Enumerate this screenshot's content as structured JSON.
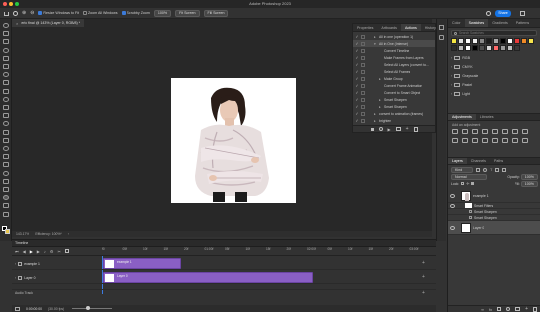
{
  "app": {
    "title": "Adobe Photoshop 2023"
  },
  "options_bar": {
    "resize_windows": "Resize Windows to Fit",
    "zoom_all": "Zoom All Windows",
    "scrubby_zoom": "Scrubby Zoom",
    "zoom_level": "100%",
    "fit_screen": "Fit Screen",
    "fill_screen": "Fill Screen",
    "share": "Share"
  },
  "document": {
    "tab_label": "eric final @ 143% (Layer 0, RGB/8) *"
  },
  "status": {
    "zoom": "143.17%",
    "efficiency": "Efficiency: 100%*"
  },
  "actions_panel": {
    "tabs": [
      "Properties",
      "Artboards",
      "Actions",
      "History"
    ],
    "items": [
      {
        "label": "All in one (operation 1)",
        "indent": 1,
        "arrow": "▸"
      },
      {
        "label": "All in One (Intense)",
        "indent": 1,
        "arrow": "▾"
      },
      {
        "label": "Convert Timeline",
        "indent": 2,
        "arrow": ""
      },
      {
        "label": "Make Frames from Layers",
        "indent": 2,
        "arrow": ""
      },
      {
        "label": "Select All Layers (convert to...",
        "indent": 2,
        "arrow": ""
      },
      {
        "label": "Select All Frames",
        "indent": 2,
        "arrow": ""
      },
      {
        "label": "Make Group",
        "indent": 2,
        "arrow": "▸"
      },
      {
        "label": "Convert Frame Animation",
        "indent": 2,
        "arrow": ""
      },
      {
        "label": "Convert to Smart Object",
        "indent": 2,
        "arrow": ""
      },
      {
        "label": "Smart Sharpen",
        "indent": 2,
        "arrow": "▸"
      },
      {
        "label": "Smart Sharpen",
        "indent": 2,
        "arrow": "▸"
      },
      {
        "label": "convert to animation (frames)",
        "indent": 1,
        "arrow": "▸"
      },
      {
        "label": "brighten",
        "indent": 1,
        "arrow": "▸"
      },
      {
        "label": "Strided on Clarity",
        "indent": 0,
        "arrow": "▸"
      }
    ]
  },
  "color_panel": {
    "tabs": [
      "Color",
      "Swatches",
      "Gradients",
      "Patterns"
    ],
    "search_placeholder": "Search Swatches",
    "swatches": [
      "#f5e642",
      "#e0e0e0",
      "#ffffff",
      "#f2f2f2",
      "#888888",
      "#1c1c1c",
      "#aaaaaa",
      "#000000",
      "#ffffff",
      "#e93a3a",
      "#f08a26",
      "#f6e34c",
      "#2d2d2d",
      "#bbbbbb",
      "#ffffff",
      "#000000",
      "#4d4d4d",
      "#d6d6d6",
      "#ff6a6a",
      "#9b9b9b",
      "#bdbdbd",
      "#3a3a3a"
    ],
    "folders": [
      "RGB",
      "CMYK",
      "Grayscale",
      "Pastel",
      "Light"
    ]
  },
  "adjustments_panel": {
    "tabs": [
      "Adjustments",
      "Libraries"
    ],
    "add_label": "Add an adjustment"
  },
  "layers_panel": {
    "tabs": [
      "Layers",
      "Channels",
      "Paths"
    ],
    "kind": "Kind",
    "blend_mode": "Normal",
    "opacity_label": "Opacity:",
    "opacity": "100%",
    "lock_label": "Lock:",
    "fill_label": "Fill:",
    "fill": "100%",
    "layers": [
      {
        "name": "example 1",
        "type": "photo",
        "indent": 0
      },
      {
        "name": "Smart Filters",
        "type": "filter",
        "indent": 1
      },
      {
        "name": "Smart Sharpen",
        "type": "sub",
        "indent": 2
      },
      {
        "name": "Smart Sharpen",
        "type": "sub",
        "indent": 2
      },
      {
        "name": "Layer 0",
        "type": "white",
        "indent": 0
      }
    ]
  },
  "timeline": {
    "title": "Timeline",
    "ruler": [
      "f0",
      "05f",
      "10f",
      "15f",
      "20f",
      "01:00f",
      "05f",
      "10f",
      "15f",
      "20f",
      "02:00f",
      "05f",
      "10f",
      "15f",
      "20f",
      "03:00f"
    ],
    "tracks": [
      {
        "name": "example 1",
        "clip": "example 1"
      },
      {
        "name": "Layer 0",
        "clip": "Layer 0"
      }
    ],
    "audio_track": "Audio Track",
    "time_display": "0:00:00:00",
    "fps": "(30.00 fps)"
  }
}
